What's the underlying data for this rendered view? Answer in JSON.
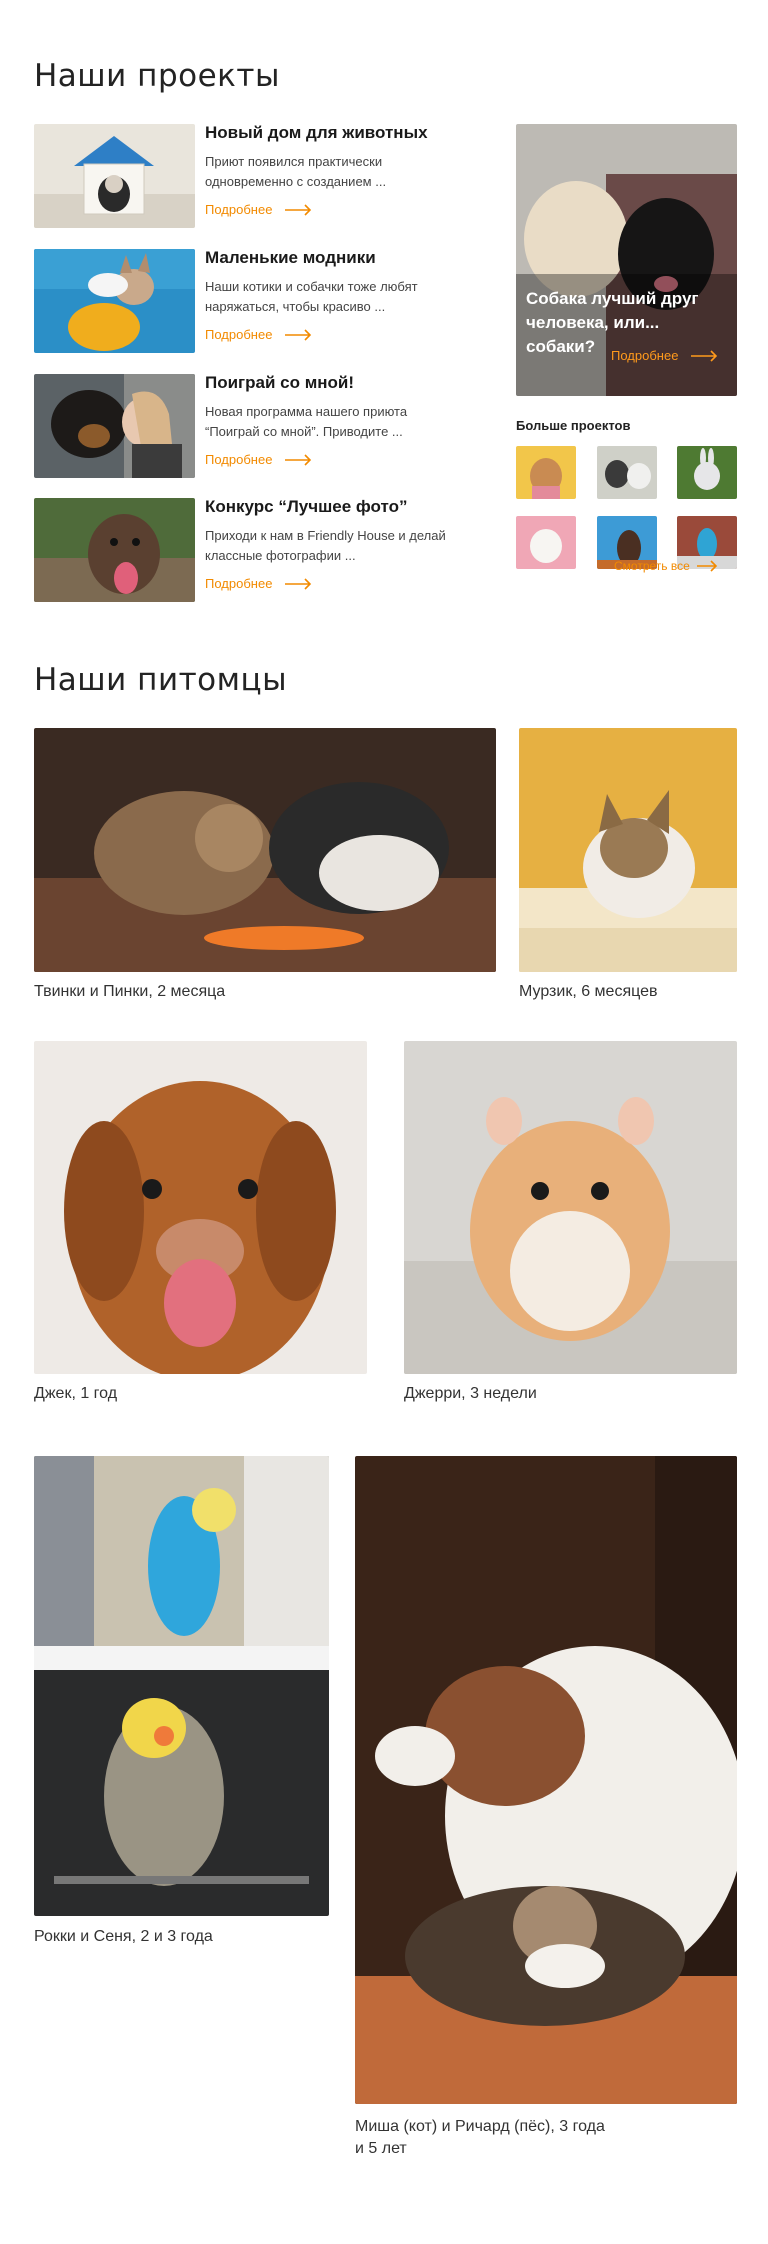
{
  "projects_section": {
    "title": "Наши проекты",
    "items": [
      {
        "title": "Новый дом для животных",
        "desc": "Приют появился практически одновременно с созданием ...",
        "more": "Подробнее"
      },
      {
        "title": "Маленькие модники",
        "desc": "Наши котики и собачки тоже любят наряжаться, чтобы красиво ...",
        "more": "Подробнее"
      },
      {
        "title": "Поиграй со мной!",
        "desc": "Новая программа нашего приюта “Поиграй со мной”. Приводите ...",
        "more": "Подробнее"
      },
      {
        "title": "Конкурс “Лучшее фото”",
        "desc": "Приходи к нам в Friendly House и делай классные фотографии ...",
        "more": "Подробнее"
      }
    ],
    "featured": {
      "title": "Собака лучший друг человека, или... собаки?",
      "more": "Подробнее"
    },
    "more_projects_label": "Больше проектов",
    "see_all": "Смотреть все"
  },
  "pets_section": {
    "title": "Наши питомцы",
    "pets": [
      {
        "caption": "Твинки и Пинки, 2 месяца"
      },
      {
        "caption": "Мурзик, 6 месяцев"
      },
      {
        "caption": "Джек, 1 год"
      },
      {
        "caption": "Джерри, 3 недели"
      },
      {
        "caption": "Рокки и Сеня, 2 и 3 года"
      },
      {
        "caption": "Миша (кот) и Ричард (пёс), 3 года и 5 лет"
      }
    ]
  },
  "colors": {
    "accent": "#f28a00",
    "text": "#1c1c1c",
    "caption": "#333333"
  },
  "icons": [
    "arrow-right-icon"
  ]
}
